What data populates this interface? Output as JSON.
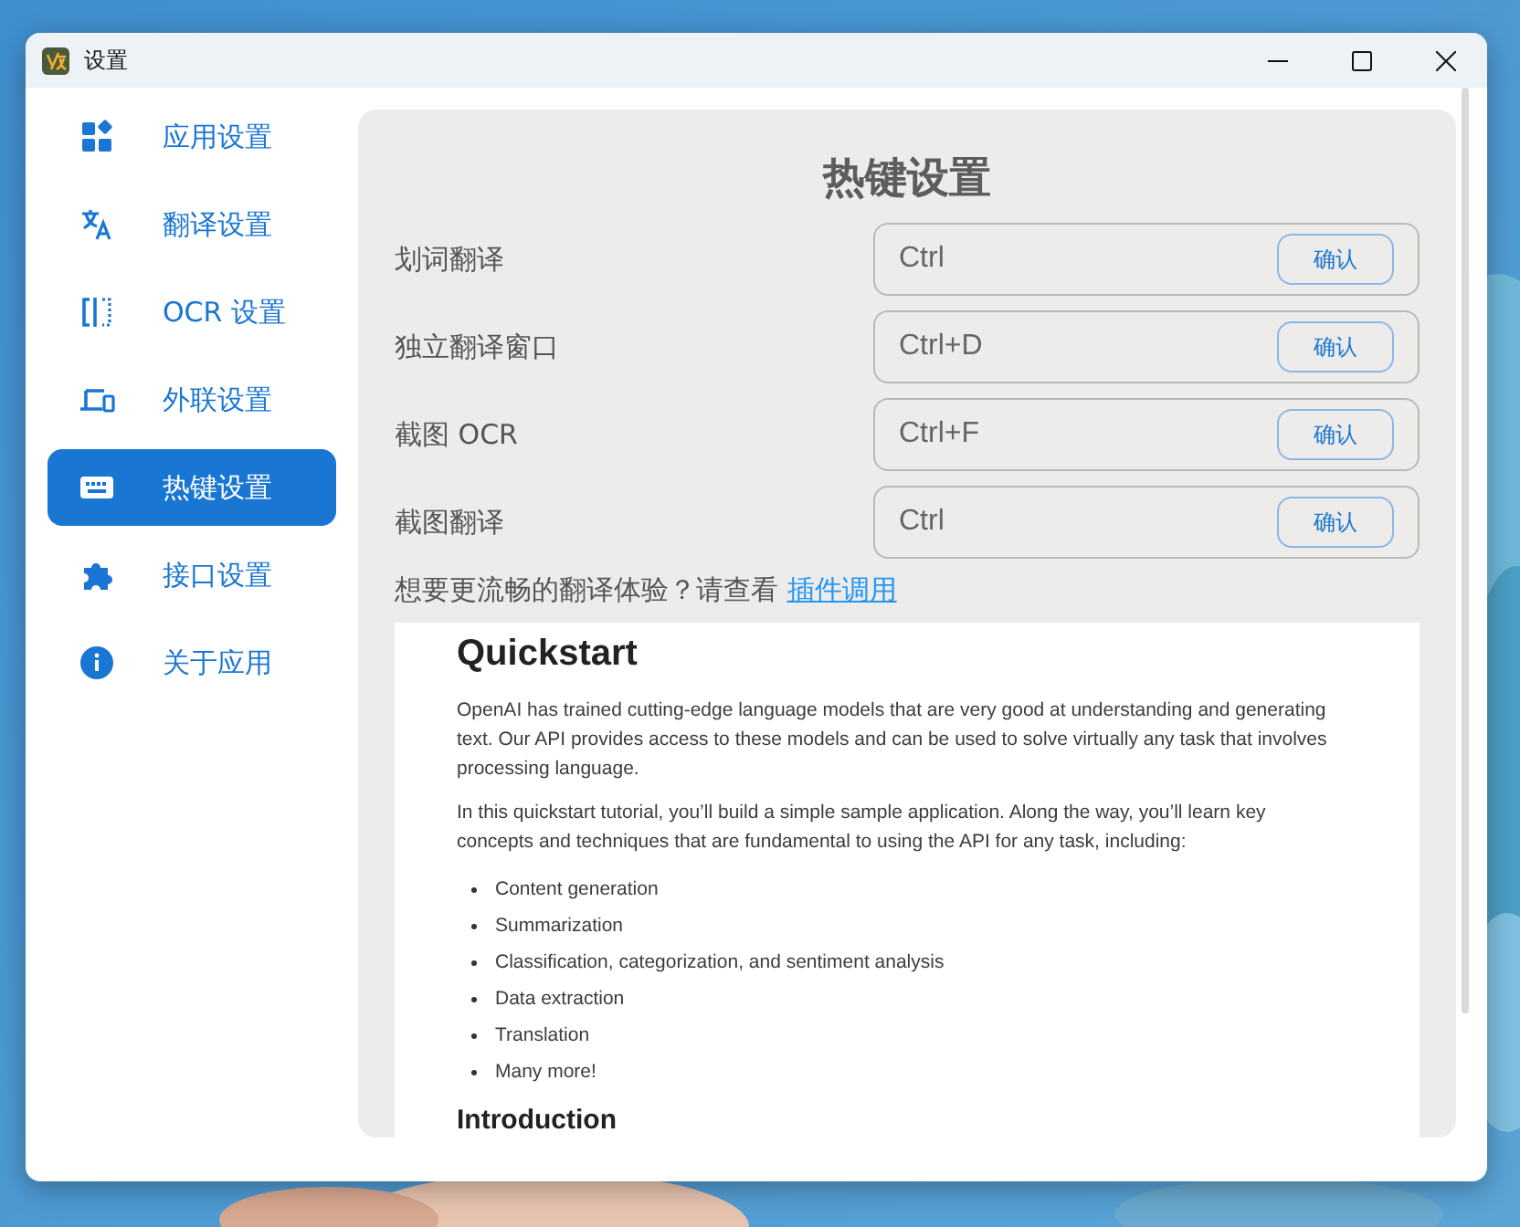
{
  "window": {
    "title": "设置"
  },
  "sidebar": {
    "items": [
      {
        "label": "应用设置",
        "selected": false
      },
      {
        "label": "翻译设置",
        "selected": false
      },
      {
        "label": "OCR 设置",
        "selected": false
      },
      {
        "label": "外联设置",
        "selected": false
      },
      {
        "label": "热键设置",
        "selected": true
      },
      {
        "label": "接口设置",
        "selected": false
      },
      {
        "label": "关于应用",
        "selected": false
      }
    ]
  },
  "hotkeys": {
    "title": "热键设置",
    "rows": [
      {
        "label": "划词翻译",
        "value": "Ctrl",
        "button": "确认"
      },
      {
        "label": "独立翻译窗口",
        "value": "Ctrl+D",
        "button": "确认"
      },
      {
        "label": "截图 OCR",
        "value": "Ctrl+F",
        "button": "确认"
      },
      {
        "label": "截图翻译",
        "value": "Ctrl",
        "button": "确认"
      }
    ]
  },
  "hint": {
    "text": "想要更流畅的翻译体验？请查看",
    "link": "插件调用"
  },
  "document": {
    "heading": "Quickstart",
    "paragraphs": [
      "OpenAI has trained cutting-edge language models that are very good at understanding and generating text. Our API provides access to these models and can be used to solve virtually any task that involves processing language.",
      "In this quickstart tutorial, you’ll build a simple sample application. Along the way, you’ll learn key concepts and techniques that are fundamental to using the API for any task, including:"
    ],
    "bullets": [
      "Content generation",
      "Summarization",
      "Classification, categorization, and sentiment analysis",
      "Data extraction",
      "Translation",
      "Many more!"
    ],
    "subheading": "Introduction"
  }
}
